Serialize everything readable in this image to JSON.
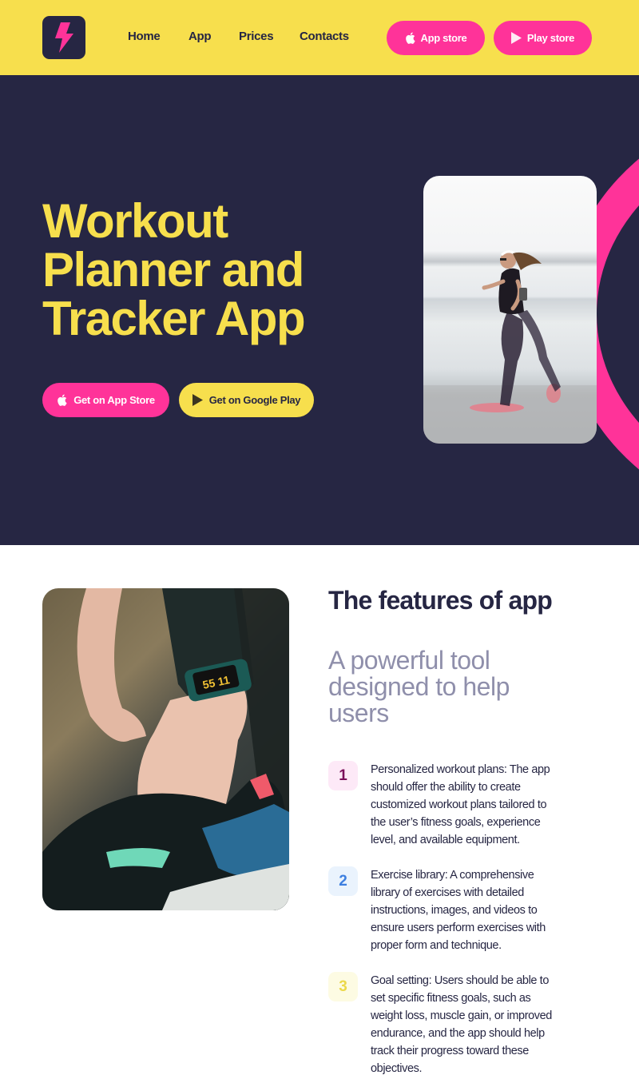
{
  "colors": {
    "yellow": "#f7df4d",
    "pink": "#ff3399",
    "navy": "#262643",
    "muted": "#8f8fab"
  },
  "header": {
    "logo_icon": "lightning-bolt-icon",
    "nav": [
      {
        "label": "Home"
      },
      {
        "label": "App"
      },
      {
        "label": "Prices"
      },
      {
        "label": "Contacts"
      }
    ],
    "buttons": [
      {
        "label": "App store",
        "icon": "apple-icon"
      },
      {
        "label": "Play store",
        "icon": "play-icon"
      }
    ]
  },
  "hero": {
    "title_lines": [
      "Workout",
      "Planner and",
      "Tracker App"
    ],
    "buttons": [
      {
        "label": "Get on App Store",
        "icon": "apple-icon"
      },
      {
        "label": "Get on Google Play",
        "icon": "play-icon"
      }
    ],
    "image_alt": "Woman running along a waterfront"
  },
  "features": {
    "image_alt": "Person with smartwatch tying sneaker laces",
    "title": "The features of app",
    "subtitle": "A powerful tool designed to help users",
    "items": [
      {
        "number": "1",
        "badge_bg": "#fde9f7",
        "badge_color": "#7a0e5a",
        "text": "Personalized workout plans: The app should offer the ability to create customized workout plans tailored to the user’s fitness goals, experience level, and available equipment."
      },
      {
        "number": "2",
        "badge_bg": "#eaf3fd",
        "badge_color": "#3d7fe0",
        "text": "Exercise library: A comprehensive library of exercises with detailed instructions, images, and videos to ensure users perform exercises with proper form and technique."
      },
      {
        "number": "3",
        "badge_bg": "#fdfbe3",
        "badge_color": "#ecd84a",
        "text": "Goal setting: Users should be able to set specific fitness goals, such as weight loss, muscle gain, or improved endurance, and the app should help track their progress toward these objectives."
      }
    ]
  }
}
